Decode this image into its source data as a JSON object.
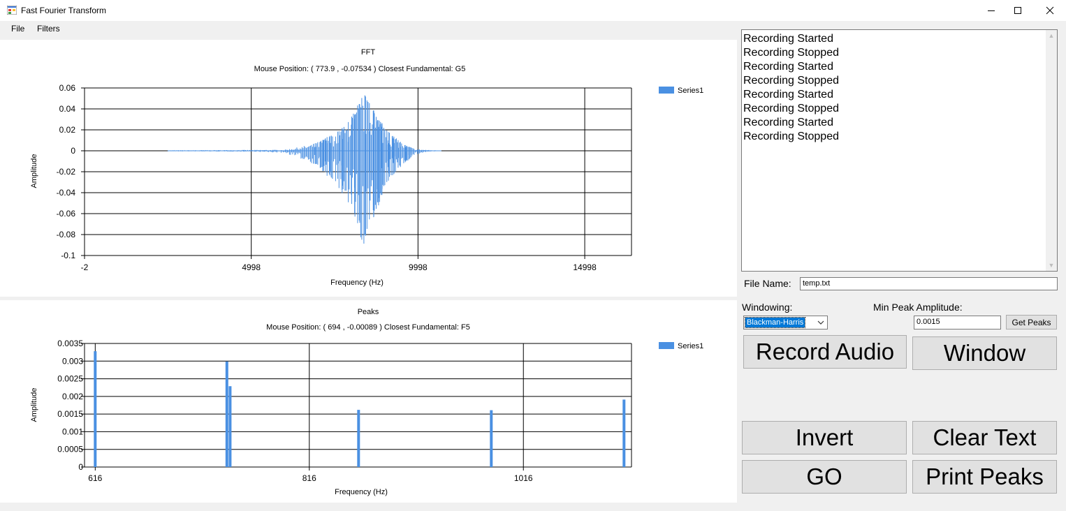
{
  "window": {
    "title": "Fast Fourier Transform"
  },
  "menu": {
    "file": "File",
    "filters": "Filters"
  },
  "fft_chart": {
    "title": "FFT",
    "subtitle": "Mouse Position: ( 773.9 , -0.07534 ) Closest Fundamental: G5",
    "xlabel": "Frequency (Hz)",
    "ylabel": "Amplitude",
    "legend": "Series1",
    "color": "#4a90e2"
  },
  "peaks_chart": {
    "title": "Peaks",
    "subtitle": "Mouse Position: ( 694 , -0.00089 ) Closest Fundamental: F5",
    "xlabel": "Frequency (Hz)",
    "ylabel": "Amplitude",
    "legend": "Series1",
    "color": "#4a90e2"
  },
  "chart_data": [
    {
      "type": "line",
      "title": "FFT",
      "xlabel": "Frequency (Hz)",
      "ylabel": "Amplitude",
      "x_ticks": [
        "-2",
        "4998",
        "9998",
        "14998"
      ],
      "y_ticks": [
        "0.06",
        "0.04",
        "0.02",
        "0",
        "-0.02",
        "-0.04",
        "-0.06",
        "-0.08",
        "-0.1"
      ],
      "xlim": [
        -2,
        16400
      ],
      "ylim": [
        -0.1,
        0.06
      ],
      "grid": true,
      "legend_position": "top-right",
      "series": [
        {
          "name": "Series1",
          "envelope": [
            {
              "x": 2500,
              "max": 0.0005,
              "min": -0.0005
            },
            {
              "x": 5000,
              "max": 0.0008,
              "min": -0.0008
            },
            {
              "x": 6000,
              "max": 0.001,
              "min": -0.002
            },
            {
              "x": 6500,
              "max": 0.004,
              "min": -0.008
            },
            {
              "x": 6900,
              "max": 0.007,
              "min": -0.013
            },
            {
              "x": 7200,
              "max": 0.012,
              "min": -0.022
            },
            {
              "x": 7500,
              "max": 0.017,
              "min": -0.03
            },
            {
              "x": 7800,
              "max": 0.024,
              "min": -0.045
            },
            {
              "x": 8000,
              "max": 0.035,
              "min": -0.058
            },
            {
              "x": 8200,
              "max": 0.045,
              "min": -0.07
            },
            {
              "x": 8300,
              "max": 0.054,
              "min": -0.093
            },
            {
              "x": 8400,
              "max": 0.055,
              "min": -0.092
            },
            {
              "x": 8550,
              "max": 0.045,
              "min": -0.072
            },
            {
              "x": 8800,
              "max": 0.033,
              "min": -0.055
            },
            {
              "x": 9000,
              "max": 0.022,
              "min": -0.035
            },
            {
              "x": 9300,
              "max": 0.013,
              "min": -0.022
            },
            {
              "x": 9600,
              "max": 0.006,
              "min": -0.012
            },
            {
              "x": 9900,
              "max": 0.002,
              "min": -0.004
            },
            {
              "x": 10300,
              "max": 0.0008,
              "min": -0.001
            },
            {
              "x": 10700,
              "max": 0.0002,
              "min": -0.0002
            }
          ]
        }
      ]
    },
    {
      "type": "bar",
      "title": "Peaks",
      "xlabel": "Frequency (Hz)",
      "ylabel": "Amplitude",
      "x_ticks": [
        "616",
        "816",
        "1016"
      ],
      "y_ticks": [
        "0.0035",
        "0.003",
        "0.0025",
        "0.002",
        "0.0015",
        "0.001",
        "0.0005",
        "0"
      ],
      "xlim": [
        606,
        1117
      ],
      "ylim": [
        0,
        0.0035
      ],
      "grid": true,
      "legend_position": "top-right",
      "series": [
        {
          "name": "Series1",
          "points": [
            {
              "x": 616,
              "y": 0.00328
            },
            {
              "x": 739,
              "y": 0.00299
            },
            {
              "x": 742,
              "y": 0.00229
            },
            {
              "x": 862,
              "y": 0.00162
            },
            {
              "x": 986,
              "y": 0.00161
            },
            {
              "x": 1110,
              "y": 0.00191
            }
          ]
        }
      ]
    }
  ],
  "log": {
    "lines": [
      "Recording Started",
      "Recording Stopped",
      "Recording Started",
      "Recording Stopped",
      "Recording Started",
      "Recording Stopped",
      "Recording Started",
      "Recording Stopped"
    ]
  },
  "controls": {
    "file_name_label": "File Name:",
    "file_name_value": "temp.txt",
    "windowing_label": "Windowing:",
    "windowing_value": "Blackman-Harris",
    "min_peak_label": "Min Peak Amplitude:",
    "min_peak_value": "0.0015",
    "get_peaks": "Get Peaks",
    "record_audio": "Record Audio",
    "window": "Window",
    "invert": "Invert",
    "clear_text": "Clear Text",
    "go": "GO",
    "print_peaks": "Print Peaks"
  }
}
